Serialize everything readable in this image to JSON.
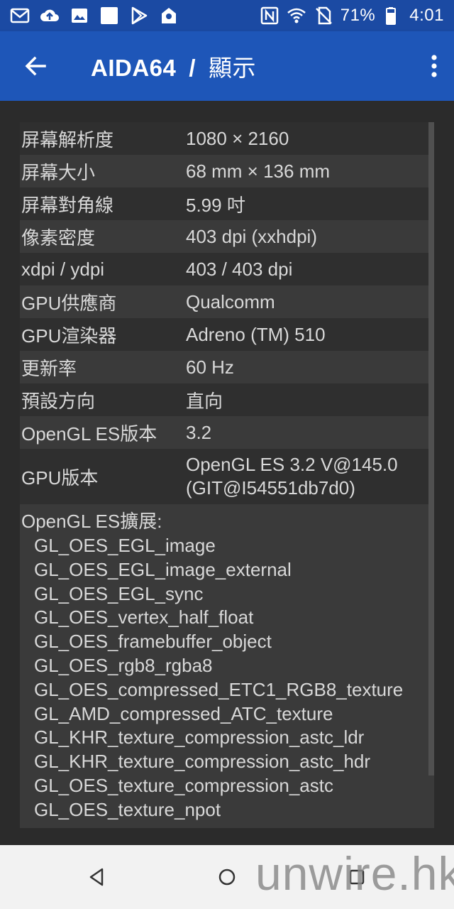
{
  "status_bar": {
    "left_icons": [
      "gmail-icon",
      "cloud-upload-icon",
      "image-icon",
      "blank-square-icon",
      "play-store-icon",
      "location-icon"
    ],
    "right_icons": [
      "nfc-icon",
      "wifi-icon",
      "no-sim-icon"
    ],
    "battery": "71%",
    "time": "4:01"
  },
  "app_bar": {
    "title": "AIDA64",
    "separator": "/",
    "subtitle": "顯示",
    "back_icon": "arrow-left-icon",
    "menu_icon": "more-vert-icon"
  },
  "rows": [
    {
      "key": "屏幕解析度",
      "value": "1080 × 2160"
    },
    {
      "key": "屏幕大小",
      "value": "68 mm × 136 mm"
    },
    {
      "key": "屏幕對角線",
      "value": "5.99 吋"
    },
    {
      "key": "像素密度",
      "value": "403 dpi (xxhdpi)"
    },
    {
      "key": "xdpi / ydpi",
      "value": "403 / 403 dpi"
    },
    {
      "key": "GPU供應商",
      "value": "Qualcomm"
    },
    {
      "key": "GPU渲染器",
      "value": "Adreno (TM) 510"
    },
    {
      "key": "更新率",
      "value": "60 Hz"
    },
    {
      "key": "預設方向",
      "value": "直向"
    },
    {
      "key": "OpenGL ES版本",
      "value": "3.2"
    },
    {
      "key": "GPU版本",
      "value_line1": "OpenGL ES 3.2 V@145.0",
      "value_line2": "(GIT@I54551db7d0)"
    }
  ],
  "extensions": {
    "title": "OpenGL ES擴展:",
    "items": [
      "GL_OES_EGL_image",
      "GL_OES_EGL_image_external",
      "GL_OES_EGL_sync",
      "GL_OES_vertex_half_float",
      "GL_OES_framebuffer_object",
      "GL_OES_rgb8_rgba8",
      "GL_OES_compressed_ETC1_RGB8_texture",
      "GL_AMD_compressed_ATC_texture",
      "GL_KHR_texture_compression_astc_ldr",
      "GL_KHR_texture_compression_astc_hdr",
      "GL_OES_texture_compression_astc",
      "GL_OES_texture_npot"
    ]
  },
  "nav_bar": {
    "icons": [
      "back-triangle-icon",
      "home-circle-icon",
      "recents-square-icon"
    ]
  },
  "watermark": "unwire.hk",
  "colors": {
    "status_bar": "#1b4aa3",
    "app_bar": "#1e56b8",
    "background": "#2b2b2b",
    "row_even": "#3a3a3a",
    "row_odd": "#2f2f2f",
    "text": "#d8d8d8"
  }
}
